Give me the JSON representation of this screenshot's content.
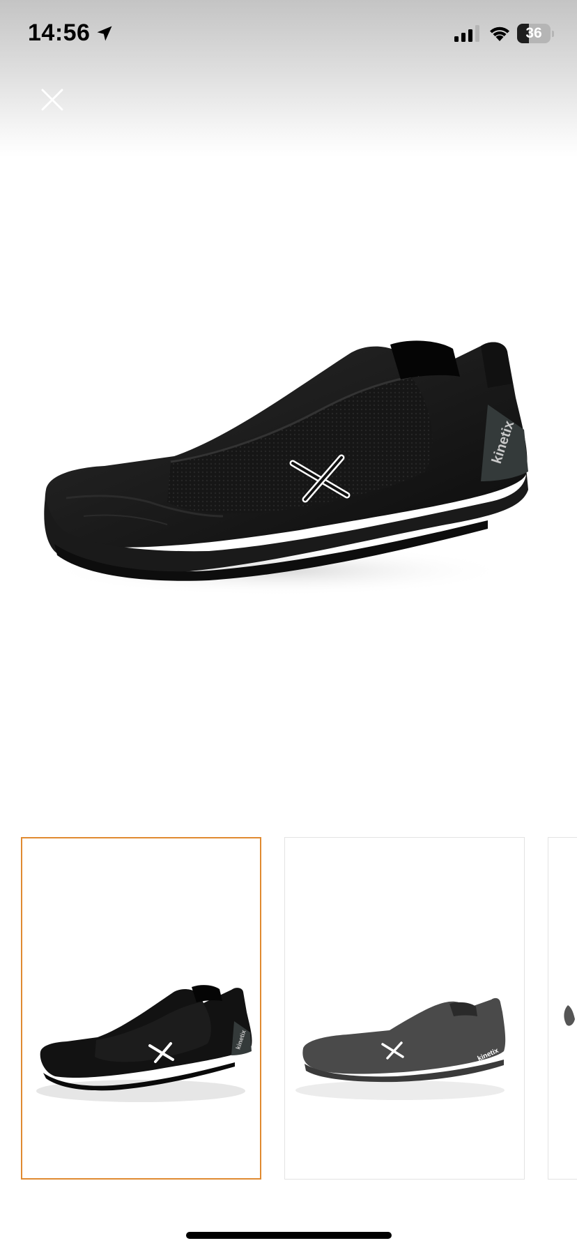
{
  "status_bar": {
    "time": "14:56",
    "battery_level": "36",
    "battery_fraction": 0.36,
    "signal_bars_filled": 3,
    "signal_bars_total": 4
  },
  "header": {
    "close_icon": "close-icon"
  },
  "main_image": {
    "alt": "Black slip-on sneaker",
    "brand_text": "kinetix",
    "shoe_color": "#121212"
  },
  "thumbnails": [
    {
      "alt": "Black slip-on sneaker view 1",
      "selected": true,
      "shoe_color": "#121212",
      "brand_text": "kinetix"
    },
    {
      "alt": "Black slip-on sneaker view 2",
      "selected": false,
      "shoe_color": "#4a4a4a",
      "brand_text": "kinetix"
    },
    {
      "alt": "Black slip-on sneaker view 3",
      "selected": false,
      "shoe_color": "#555555",
      "brand_text": ""
    }
  ],
  "colors": {
    "selected_border": "#e08a30",
    "thumb_border": "#e3e3e3",
    "background": "#ffffff"
  }
}
